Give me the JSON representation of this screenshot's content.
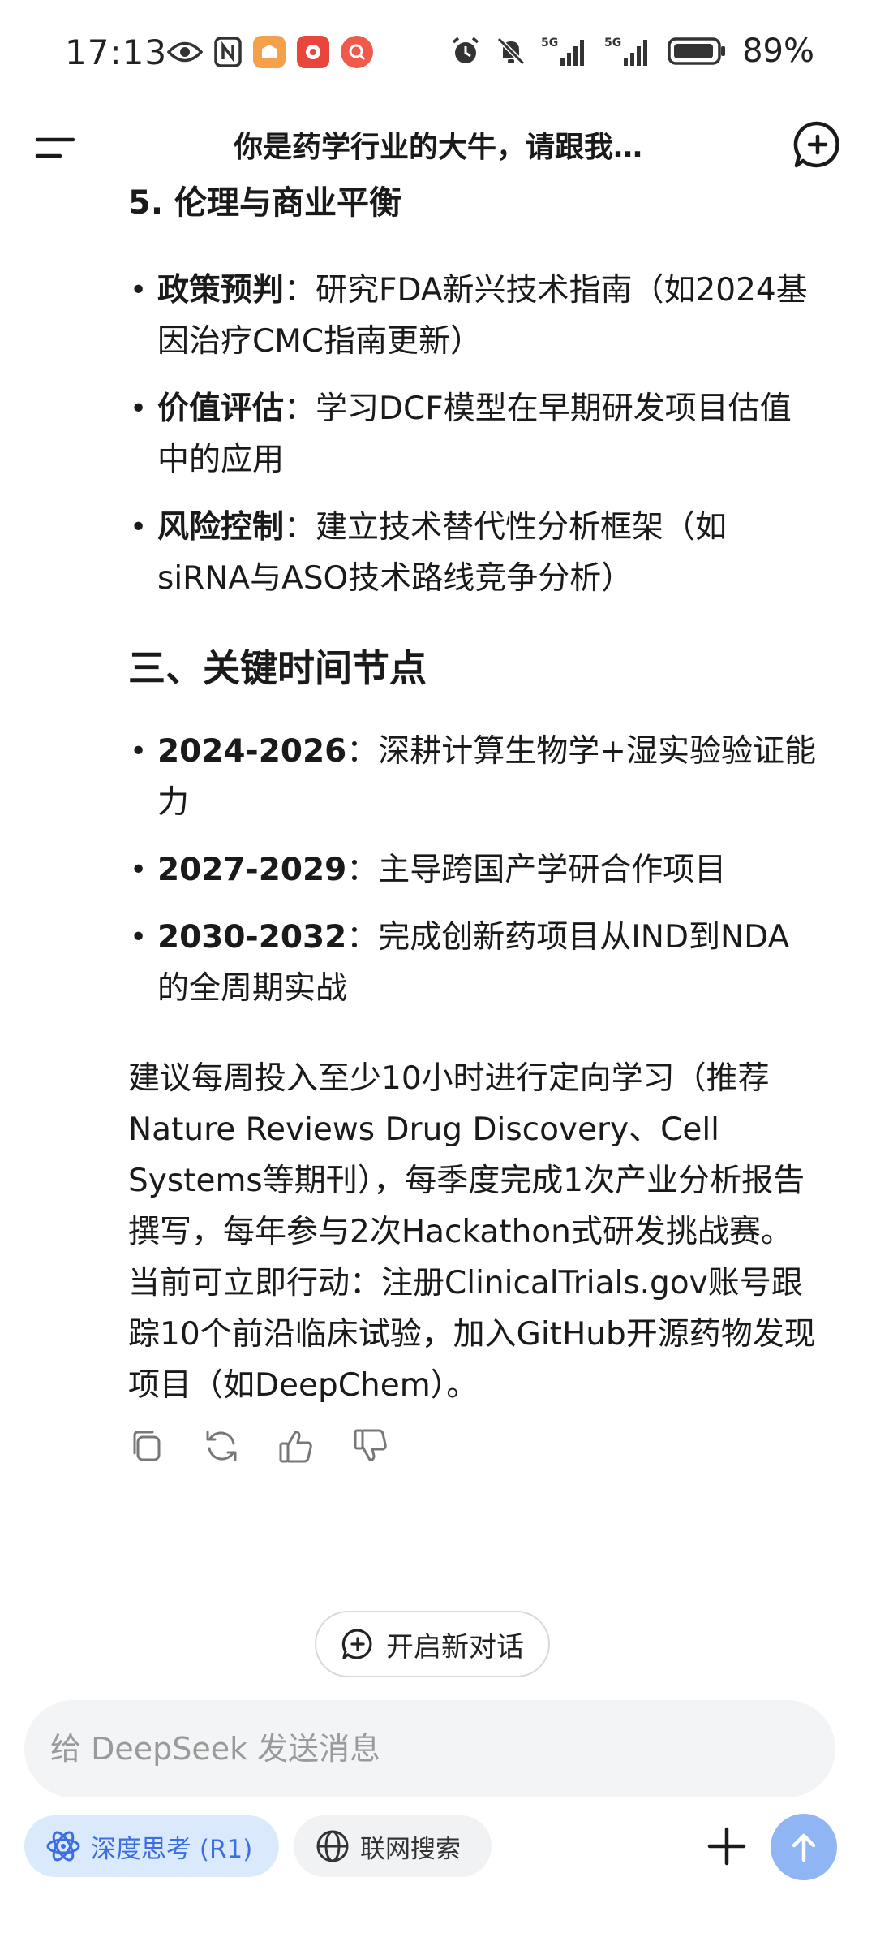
{
  "status_bar": {
    "time": "17:13",
    "battery": "89%"
  },
  "header": {
    "title": "你是药学行业的大牛，请跟我…"
  },
  "content": {
    "section5_heading": "5. 伦理与商业平衡",
    "section5_items": [
      {
        "label": "政策预判",
        "sep": "：",
        "text": "研究FDA新兴技术指南（如2024基因治疗CMC指南更新）"
      },
      {
        "label": "价值评估",
        "sep": "：",
        "text": "学习DCF模型在早期研发项目估值中的应用"
      },
      {
        "label": "风险控制",
        "sep": "：",
        "text": "建立技术替代性分析框架（如siRNA与ASO技术路线竞争分析）"
      }
    ],
    "section3_heading": "三、关键时间节点",
    "timeline_items": [
      {
        "label": "2024-2026",
        "sep": "：",
        "text": "深耕计算生物学+湿实验验证能力"
      },
      {
        "label": "2027-2029",
        "sep": "：",
        "text": "主导跨国产学研合作项目"
      },
      {
        "label": "2030-2032",
        "sep": "：",
        "text": "完成创新药项目从IND到NDA的全周期实战"
      }
    ],
    "closing_paragraph": "建议每周投入至少10小时进行定向学习（推荐Nature Reviews Drug Discovery、Cell Systems等期刊），每季度完成1次产业分析报告撰写，每年参与2次Hackathon式研发挑战赛。当前可立即行动：注册ClinicalTrials.gov账号跟踪10个前沿临床试验，加入GitHub开源药物发现项目（如DeepChem）。"
  },
  "new_dialog_label": "开启新对话",
  "composer": {
    "placeholder": "给 DeepSeek 发送消息",
    "deep_think_label": "深度思考 (R1)",
    "web_search_label": "联网搜索"
  },
  "colors": {
    "accent": "#3b6ee0",
    "accent_bg": "#dbe9fd",
    "send_button": "#8fb5f5",
    "input_bg": "#f3f4f6"
  }
}
